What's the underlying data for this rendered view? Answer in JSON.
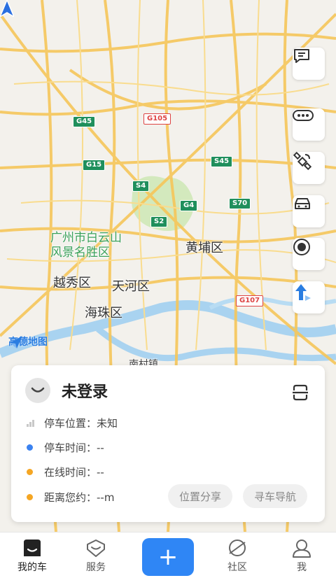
{
  "map": {
    "labels": {
      "baiyunshan": "广州市白云山\n风景名胜区",
      "huangpu": "黄埔区",
      "yuexiu": "越秀区",
      "tianhe": "天河区",
      "haizhu": "海珠区",
      "nancun": "南村镇"
    },
    "road_badges": {
      "g45": "G45",
      "g105": "G105",
      "g15": "G15",
      "s4": "S4",
      "s45": "S45",
      "g4": "G4",
      "s70": "S70",
      "s2": "S2",
      "g107": "G107"
    },
    "provider": "高德地图"
  },
  "side_buttons": {
    "messages": "message-icon",
    "more": "more-icon",
    "satellite": "satellite-icon",
    "car": "car-icon",
    "record": "record-icon",
    "direction": "direction-arrow-icon"
  },
  "card": {
    "title": "未登录",
    "rows": {
      "park_location": "停车位置：未知",
      "park_time": "停车时间：--",
      "online_time": "在线时间：--",
      "distance": "距离您约：--m"
    },
    "share_button": "位置分享",
    "nav_button": "寻车导航",
    "colors": {
      "blue": "#3b82f0",
      "orange": "#f5a623"
    }
  },
  "tabs": {
    "my_car": "我的车",
    "service": "服务",
    "community": "社区",
    "me": "我",
    "add": "+"
  }
}
